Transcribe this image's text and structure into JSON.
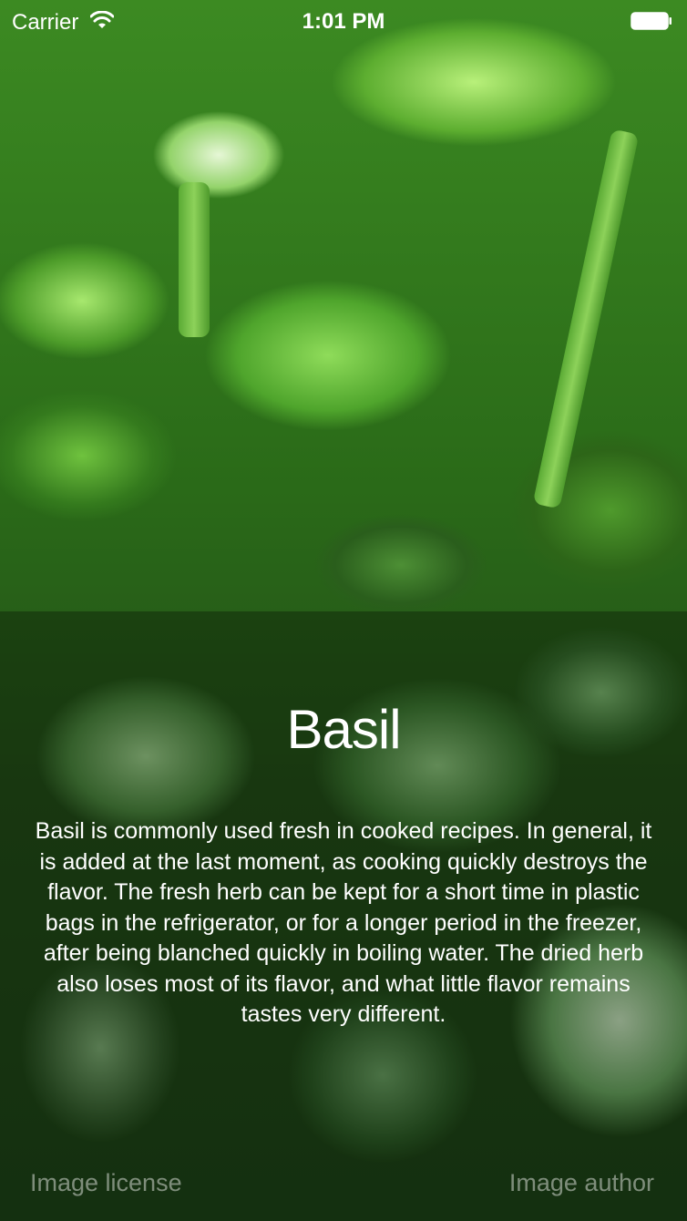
{
  "status_bar": {
    "carrier": "Carrier",
    "time": "1:01 PM",
    "icons": [
      "wifi-icon",
      "battery-icon"
    ]
  },
  "plant": {
    "name": "Basil",
    "description": "Basil is commonly used fresh in cooked recipes. In general, it is added at the last moment, as cooking quickly destroys the flavor. The fresh herb can be kept for a short time in plastic bags in the refrigerator, or for a longer period in the freezer, after being blanched quickly in boiling water. The dried herb also loses most of its flavor, and what little flavor remains tastes very different."
  },
  "footer": {
    "license_label": "Image license",
    "author_label": "Image author"
  }
}
